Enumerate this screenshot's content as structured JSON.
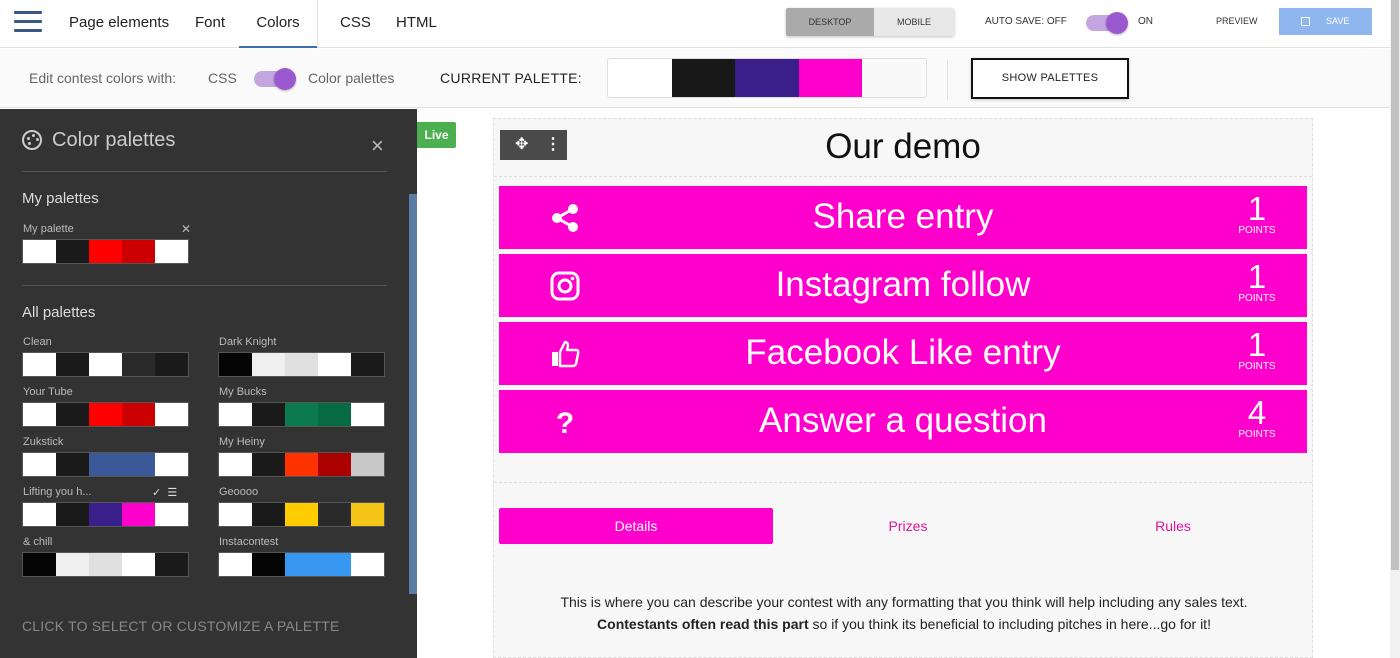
{
  "topnav": {
    "tabs": [
      "Page elements",
      "Font",
      "Colors",
      "CSS",
      "HTML"
    ],
    "active_tab": "Colors"
  },
  "device": {
    "desktop": "DESKTOP",
    "mobile": "MOBILE",
    "active": "DESKTOP"
  },
  "autosave": {
    "label": "AUTO SAVE: OFF",
    "state_label": "ON"
  },
  "actions": {
    "preview": "PREVIEW",
    "save": "SAVE"
  },
  "subbar": {
    "edit_with": "Edit contest colors with:",
    "css": "CSS",
    "palettes": "Color palettes",
    "current_palette": "CURRENT PALETTE:",
    "current_colors": [
      "#ffffff",
      "#181818",
      "#3a1f8a",
      "#ff00cc",
      "#f9f9f9"
    ],
    "show_palettes": "SHOW PALETTES"
  },
  "sidebar": {
    "title": "Color palettes",
    "my_palettes_heading": "My palettes",
    "my_palette": {
      "name": "My palette",
      "colors": [
        "#ffffff",
        "#1a1a1a",
        "#ff0000",
        "#cc0000",
        "#ffffff"
      ]
    },
    "all_palettes_heading": "All palettes",
    "palettes": [
      {
        "name": "Clean",
        "colors": [
          "#ffffff",
          "#1a1a1a",
          "#ffffff",
          "#2a2a2a",
          "#1a1a1a"
        ]
      },
      {
        "name": "Dark Knight",
        "colors": [
          "#050505",
          "#f0f0f0",
          "#e0e0e0",
          "#ffffff",
          "#1a1a1a"
        ]
      },
      {
        "name": "Your Tube",
        "colors": [
          "#ffffff",
          "#1a1a1a",
          "#ff0000",
          "#cc0000",
          "#ffffff"
        ]
      },
      {
        "name": "My Bucks",
        "colors": [
          "#ffffff",
          "#1a1a1a",
          "#0b7a4e",
          "#066b42",
          "#ffffff"
        ]
      },
      {
        "name": "Zukstick",
        "colors": [
          "#ffffff",
          "#1a1a1a",
          "#3b5998",
          "#3b5998",
          "#ffffff"
        ]
      },
      {
        "name": "My Heiny",
        "colors": [
          "#ffffff",
          "#1a1a1a",
          "#ff3300",
          "#aa0000",
          "#c8c8c8"
        ]
      },
      {
        "name": "Lifting you h...",
        "colors": [
          "#ffffff",
          "#1a1a1a",
          "#3a1f8a",
          "#ff00cc",
          "#ffffff"
        ]
      },
      {
        "name": "Geoooo",
        "colors": [
          "#ffffff",
          "#1a1a1a",
          "#ffcc00",
          "#2a2a2a",
          "#f5c518"
        ]
      },
      {
        "name": "& chill",
        "colors": [
          "#050505",
          "#f0f0f0",
          "#e0e0e0",
          "#ffffff",
          "#1a1a1a"
        ]
      },
      {
        "name": "Instacontest",
        "colors": [
          "#ffffff",
          "#050505",
          "#3897f0",
          "#3897f0",
          "#ffffff"
        ]
      }
    ],
    "footer": "CLICK TO SELECT OR CUSTOMIZE A PALETTE"
  },
  "canvas": {
    "live": "Live",
    "title": "Our demo",
    "entries": [
      {
        "label": "Share entry",
        "points": "1",
        "points_word": "POINTS",
        "icon": "share-icon"
      },
      {
        "label": "Instagram follow",
        "points": "1",
        "points_word": "POINTS",
        "icon": "instagram-icon"
      },
      {
        "label": "Facebook Like entry",
        "points": "1",
        "points_word": "POINTS",
        "icon": "thumbs-up-icon"
      },
      {
        "label": "Answer a question",
        "points": "4",
        "points_word": "POINTS",
        "icon": "question-icon"
      }
    ],
    "tabs": [
      "Details",
      "Prizes",
      "Rules"
    ],
    "active_tab": "Details",
    "desc_1": "This is where you can describe your contest with any formatting that you think will help including any sales text.",
    "desc_bold": "Contestants often read this part",
    "desc_2": "so if you think its beneficial to including pitches in here...go for it!"
  },
  "colors": {
    "accent": "#ff00cc",
    "live": "#4caf50",
    "toggle": "#9b59d0"
  }
}
